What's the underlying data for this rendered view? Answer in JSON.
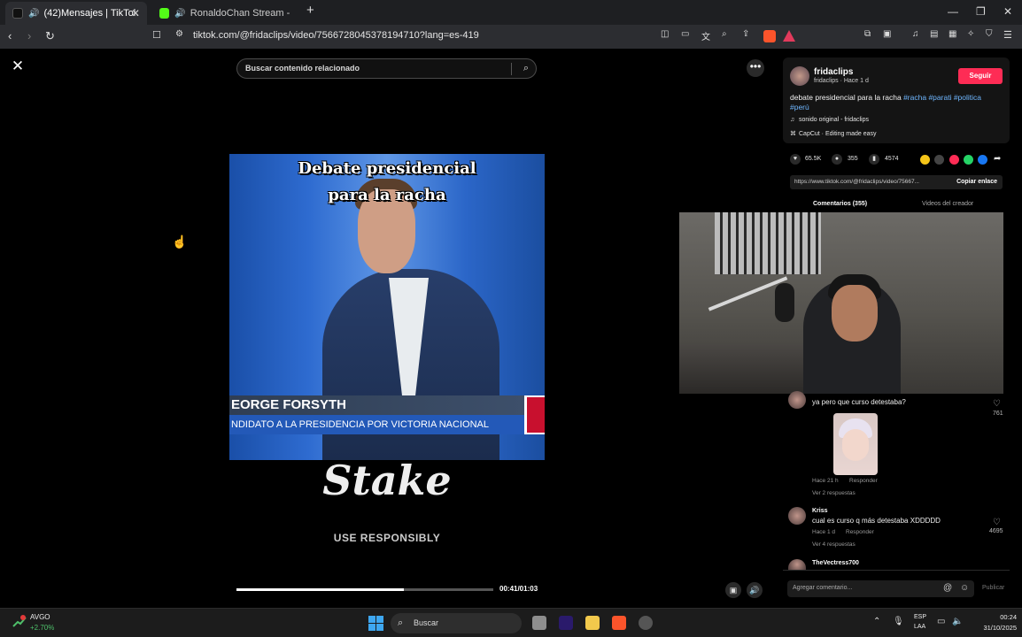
{
  "browser": {
    "tabs": [
      {
        "label": "(42)Mensajes | TikTok",
        "favicon": "tiktok-icon",
        "audio": true
      },
      {
        "label": "RonaldoChan Stream - Watch Li",
        "favicon": "kick-icon",
        "audio": true
      }
    ],
    "url": "tiktok.com/@fridaclips/video/7566728045378194710?lang=es-419",
    "accent": "#fe2c55"
  },
  "page": {
    "search_placeholder": "Buscar contenido relacionado",
    "creator": {
      "username": "fridaclips",
      "meta": "fridaclips · Hace 1 d",
      "follow_label": "Seguir"
    },
    "description": "debate presidencial para la racha",
    "hashtags": [
      "#racha",
      "#parati",
      "#politica",
      "#perú"
    ],
    "sound": "sonido original - fridaclips",
    "effect": "CapCut · Editing made easy",
    "stats": {
      "likes": "65.5K",
      "comments": "355",
      "saves": "4574"
    },
    "share_link": "https://www.tiktok.com/@fridaclips/video/75667...",
    "copy_link_label": "Copiar enlace",
    "tabs": {
      "comments": "Comentarios (355)",
      "creator_videos": "Videos del creador"
    },
    "comments": [
      {
        "name": "",
        "text": "ya pero que curso detestaba?",
        "meta": "Hace 21 h",
        "reply_label": "Responder",
        "replies": "Ver 2 respuestas",
        "likes": "761"
      },
      {
        "name": "Kriss",
        "text": "cual es curso q más detestaba XDDDDD",
        "meta": "Hace 1 d",
        "reply_label": "Responder",
        "replies": "Ver 4 respuestas",
        "likes": "4695"
      },
      {
        "name": "TheVectress700",
        "text": "",
        "meta": "",
        "reply_label": "",
        "replies": "",
        "likes": ""
      }
    ],
    "comment_placeholder": "Agregar comentario...",
    "publish_label": "Publicar"
  },
  "video": {
    "caption_line1": "Debate presidencial",
    "caption_line2": "para la racha",
    "lower_third_name": "EORGE FORSYTH",
    "lower_third_role": "NDIDATO A LA PRESIDENCIA POR VICTORIA NACIONAL",
    "sponsor": "Stake",
    "sponsor_sub": "USE RESPONSIBLY",
    "time": "00:41/01:03",
    "progress": 0.65
  },
  "taskbar": {
    "stock_name": "AVGO",
    "stock_change": "+2.70%",
    "stock_badge": "1",
    "search_label": "Buscar",
    "lang1": "ESP",
    "lang2": "LAA",
    "time": "00:24",
    "date": "31/10/2025"
  }
}
